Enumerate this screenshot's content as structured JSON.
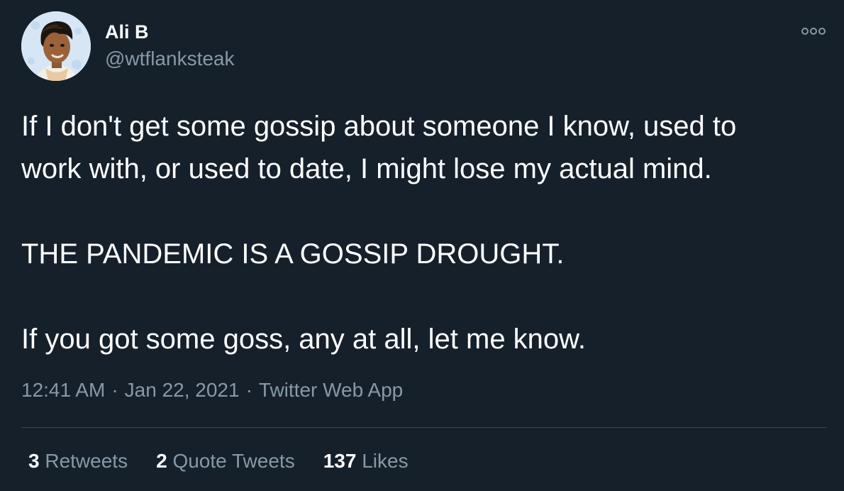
{
  "author": {
    "display_name": "Ali B",
    "handle": "@wtflanksteak",
    "avatar": "cartoon-portrait-avatar"
  },
  "tweet": {
    "paragraphs": [
      "If I don't get some gossip about someone I know, used to",
      "work with, or used to date, I might lose my actual mind.",
      "THE PANDEMIC IS A GOSSIP DROUGHT.",
      "If you got some goss, any at all, let me know."
    ]
  },
  "meta": {
    "time": "12:41 AM",
    "date": "Jan 22, 2021",
    "source": "Twitter Web App",
    "separator": "·"
  },
  "stats": {
    "retweets": {
      "count": "3",
      "label": "Retweets"
    },
    "quote_tweets": {
      "count": "2",
      "label": "Quote Tweets"
    },
    "likes": {
      "count": "137",
      "label": "Likes"
    }
  },
  "icons": {
    "more": "more-options-icon"
  },
  "colors": {
    "background": "#15202b",
    "primary_text": "#ffffff",
    "secondary_text": "#8899a6",
    "divider": "#38444d"
  }
}
